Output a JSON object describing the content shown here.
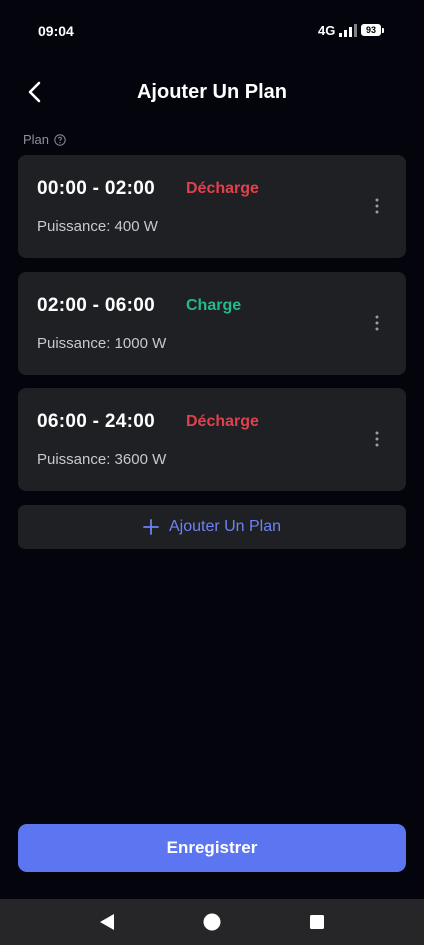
{
  "status_bar": {
    "time": "09:04",
    "network": "4G",
    "battery": "93"
  },
  "header": {
    "title": "Ajouter Un Plan"
  },
  "section": {
    "label": "Plan"
  },
  "plans": [
    {
      "time": "00:00 - 02:00",
      "mode": "Décharge",
      "power": "Puissance: 400 W"
    },
    {
      "time": "02:00 - 06:00",
      "mode": "Charge",
      "power": "Puissance: 1000 W"
    },
    {
      "time": "06:00 - 24:00",
      "mode": "Décharge",
      "power": "Puissance: 3600 W"
    }
  ],
  "add_plan": {
    "label": "Ajouter Un Plan"
  },
  "save": {
    "label": "Enregistrer"
  },
  "colors": {
    "background": "#03040c",
    "card": "#1f2023",
    "decharge": "#e0414d",
    "charge": "#25b88e",
    "accent": "#5c75f0"
  },
  "icons": {
    "back": "chevron-left-icon",
    "help": "question-circle-icon",
    "more": "more-vertical-icon",
    "add": "plus-icon",
    "nav_back": "triangle-back-icon",
    "nav_home": "circle-home-icon",
    "nav_recents": "square-recents-icon"
  }
}
